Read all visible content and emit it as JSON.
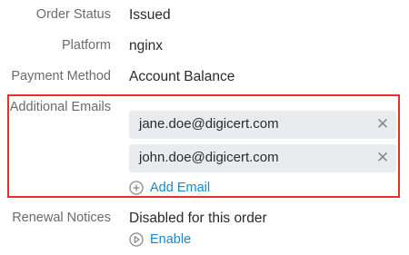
{
  "fields": {
    "order_status": {
      "label": "Order Status",
      "value": "Issued"
    },
    "platform": {
      "label": "Platform",
      "value": "nginx"
    },
    "payment_method": {
      "label": "Payment Method",
      "value": "Account Balance"
    },
    "additional_emails": {
      "label": "Additional Emails",
      "emails": [
        "jane.doe@digicert.com",
        "john.doe@digicert.com"
      ],
      "remove_icon": "close-icon",
      "add_label": "Add Email",
      "add_icon": "plus-circle-icon"
    },
    "renewal_notices": {
      "label": "Renewal Notices",
      "value": "Disabled for this order",
      "enable_label": "Enable",
      "enable_icon": "play-circle-icon"
    }
  },
  "colors": {
    "highlight_border": "#e0332c",
    "link": "#1a86c9",
    "chip_bg": "#e9ecee"
  }
}
